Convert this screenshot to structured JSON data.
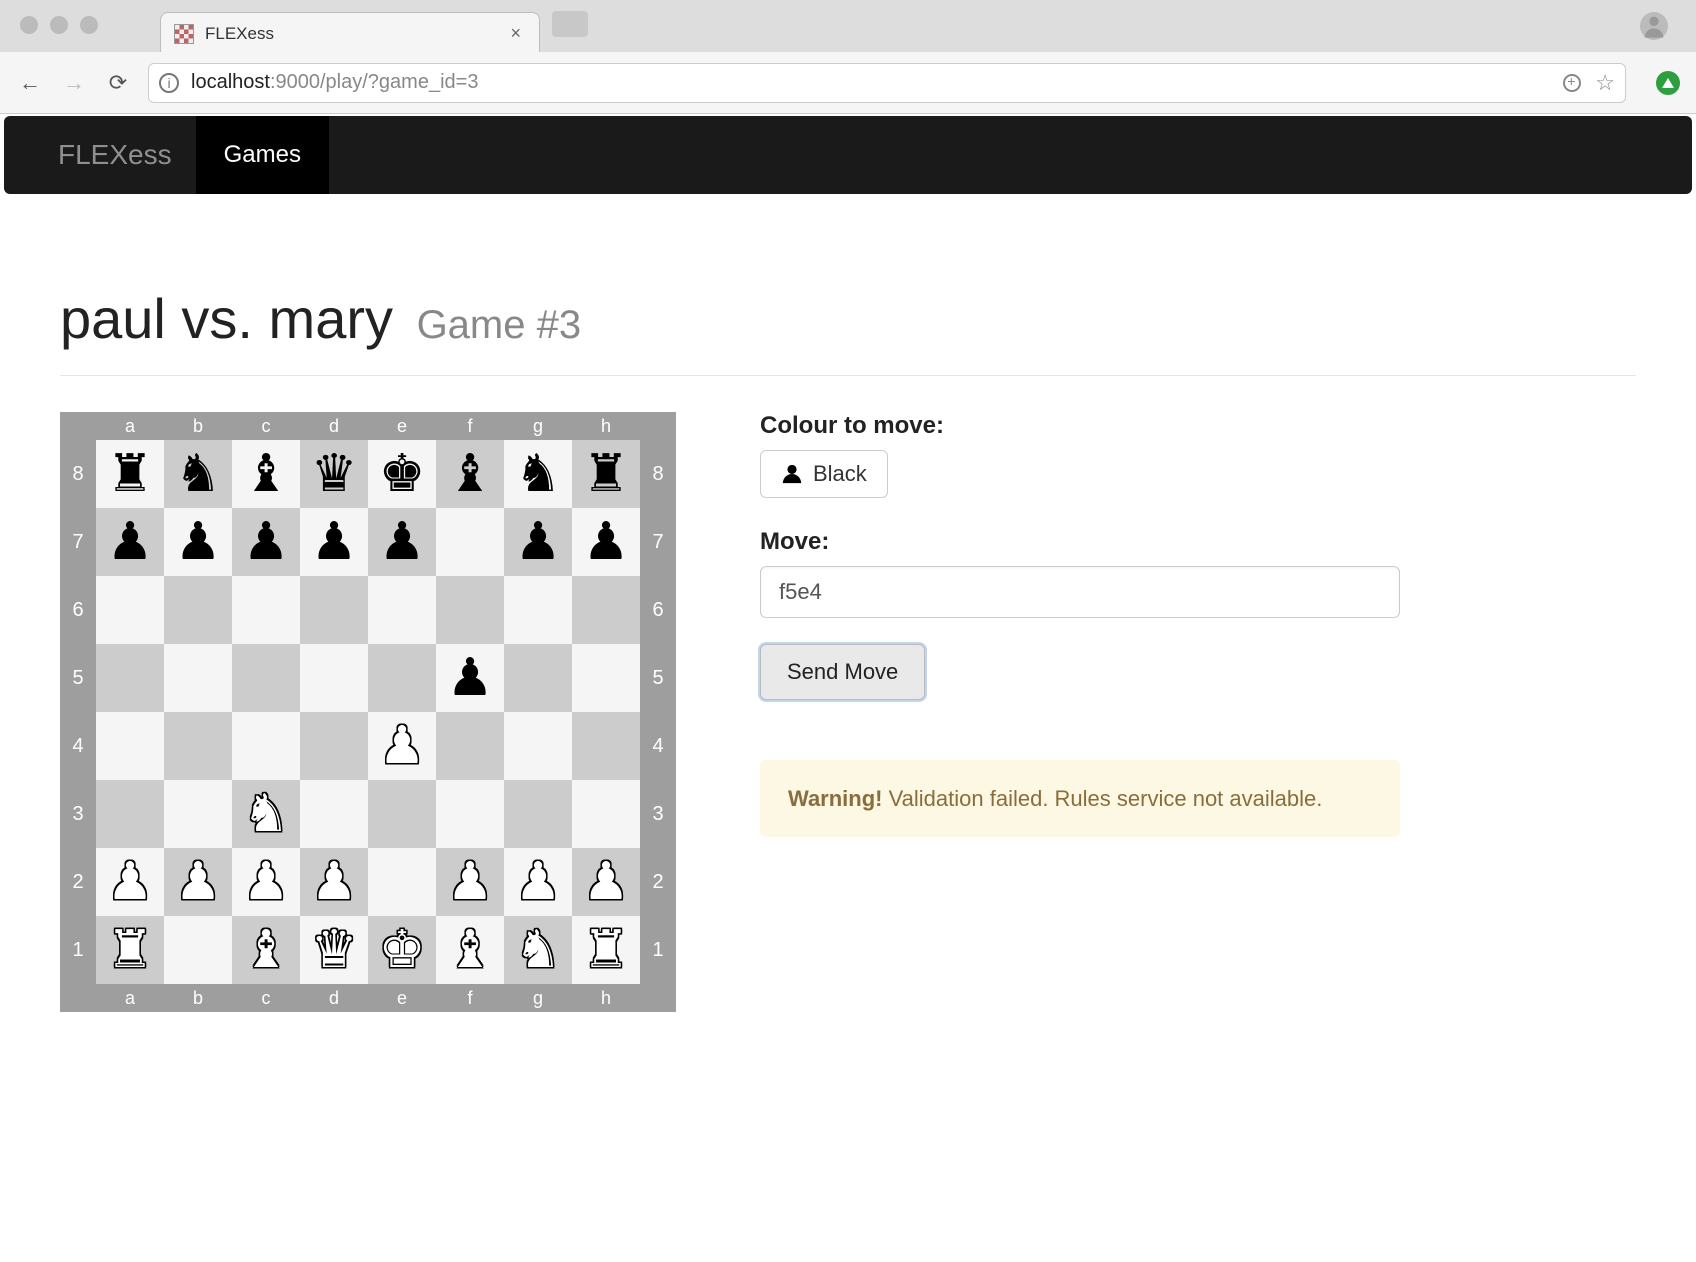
{
  "browser": {
    "tab_title": "FLEXess",
    "url_host": "localhost",
    "url_port": ":9000",
    "url_path": "/play/?game_id=3"
  },
  "nav": {
    "brand": "FLEXess",
    "items": [
      {
        "label": "Games",
        "active": true
      }
    ]
  },
  "page": {
    "title_main": "paul vs. mary",
    "title_sub": "Game #3"
  },
  "form": {
    "colour_label": "Colour to move:",
    "colour_value": "Black",
    "move_label": "Move:",
    "move_value": "f5e4",
    "send_label": "Send Move"
  },
  "alert": {
    "prefix": "Warning!",
    "message": "Validation failed. Rules service not available."
  },
  "board": {
    "files": [
      "a",
      "b",
      "c",
      "d",
      "e",
      "f",
      "g",
      "h"
    ],
    "ranks": [
      "8",
      "7",
      "6",
      "5",
      "4",
      "3",
      "2",
      "1"
    ],
    "pieces": {
      "wK": "♔",
      "wQ": "♕",
      "wR": "♖",
      "wB": "♗",
      "wN": "♘",
      "wP": "♙",
      "bK": "♚",
      "bQ": "♛",
      "bR": "♜",
      "bB": "♝",
      "bN": "♞",
      "bP": "♟"
    },
    "position": [
      [
        "bR",
        "bN",
        "bB",
        "bQ",
        "bK",
        "bB",
        "bN",
        "bR"
      ],
      [
        "bP",
        "bP",
        "bP",
        "bP",
        "bP",
        "",
        "bP",
        "bP"
      ],
      [
        "",
        "",
        "",
        "",
        "",
        "",
        "",
        ""
      ],
      [
        "",
        "",
        "",
        "",
        "",
        "bP",
        "",
        ""
      ],
      [
        "",
        "",
        "",
        "",
        "wP",
        "",
        "",
        ""
      ],
      [
        "",
        "",
        "wN",
        "",
        "",
        "",
        "",
        ""
      ],
      [
        "wP",
        "wP",
        "wP",
        "wP",
        "",
        "wP",
        "wP",
        "wP"
      ],
      [
        "wR",
        "",
        "wB",
        "wQ",
        "wK",
        "wB",
        "wN",
        "wR"
      ]
    ]
  }
}
